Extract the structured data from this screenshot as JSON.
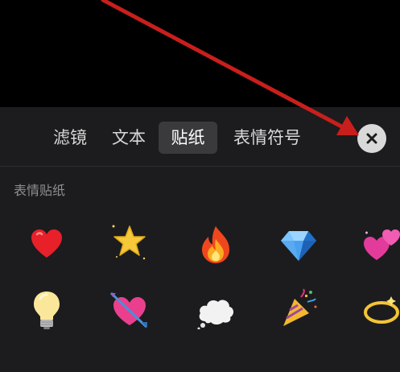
{
  "tabs": [
    {
      "label": "滤镜",
      "active": false
    },
    {
      "label": "文本",
      "active": false
    },
    {
      "label": "贴纸",
      "active": true
    },
    {
      "label": "表情符号",
      "active": false
    }
  ],
  "section_title": "表情贴纸",
  "stickers": [
    {
      "icon": "heart-sticker-icon"
    },
    {
      "icon": "star-sticker-icon"
    },
    {
      "icon": "fire-sticker-icon"
    },
    {
      "icon": "diamond-sticker-icon"
    },
    {
      "icon": "two-hearts-sticker-icon"
    },
    {
      "icon": "light-bulb-sticker-icon"
    },
    {
      "icon": "heart-arrow-sticker-icon"
    },
    {
      "icon": "cloud-sticker-icon"
    },
    {
      "icon": "party-popper-sticker-icon"
    },
    {
      "icon": "halo-sticker-icon"
    }
  ],
  "colors": {
    "panel_background": "#1c1c1e",
    "active_tab_background": "#3a3a3c",
    "annotation_arrow": "#d0201c"
  }
}
